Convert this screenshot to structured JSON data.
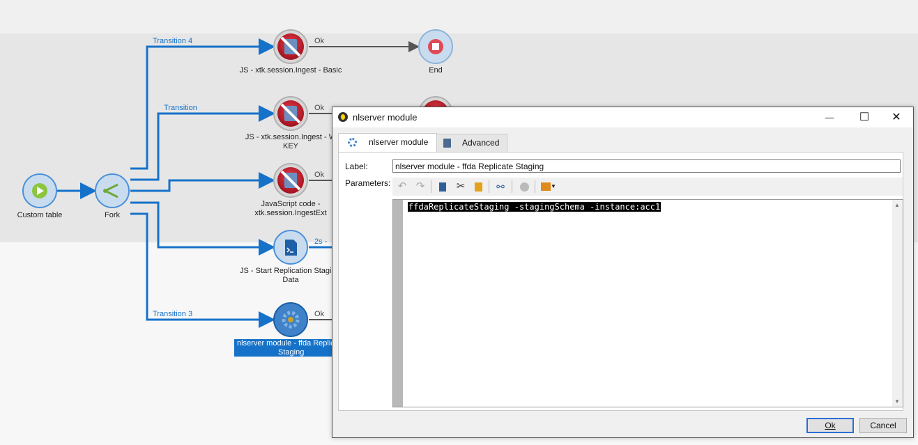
{
  "workflow": {
    "nodes": {
      "custom_table": "Custom table",
      "fork": "Fork",
      "js_basic": "JS - xtk.session.Ingest - Basic",
      "end": "End",
      "js_w_line1": "JS - xtk.session.Ingest - W",
      "js_w_line2": "KEY",
      "js_code_line1": "JavaScript code -",
      "js_code_line2": "xtk.session.IngestExt",
      "js_start_line1": "JS - Start Replication Stagi",
      "js_start_line2": "Data",
      "nlserver_line1": "nlserver module - ffda Replic",
      "nlserver_line2": "Staging"
    },
    "transitions": {
      "t4": "Transition 4",
      "t": "Transition",
      "t3": "Transition 3",
      "ok": "Ok",
      "two_s": "2s - "
    }
  },
  "dialog": {
    "title": "nlserver module",
    "window_buttons": {
      "minimize": "—",
      "maximize": "☐",
      "close": "✕"
    },
    "tabs": [
      {
        "label": "nlserver module",
        "icon": "gear-icon",
        "active": true
      },
      {
        "label": "Advanced",
        "icon": "clipboard-icon",
        "active": false
      }
    ],
    "label_caption": "Label:",
    "label_value": "nlserver module - ffda Replicate Staging",
    "parameters_caption": "Parameters:",
    "code": "ffdaReplicateStaging -stagingSchema -instance:acc1",
    "ok": "Ok",
    "cancel": "Cancel"
  },
  "colors": {
    "accent": "#1672c9",
    "start_green": "#8cc63f",
    "stop_red": "#d7263d",
    "node_blue": "#4a90d9"
  }
}
